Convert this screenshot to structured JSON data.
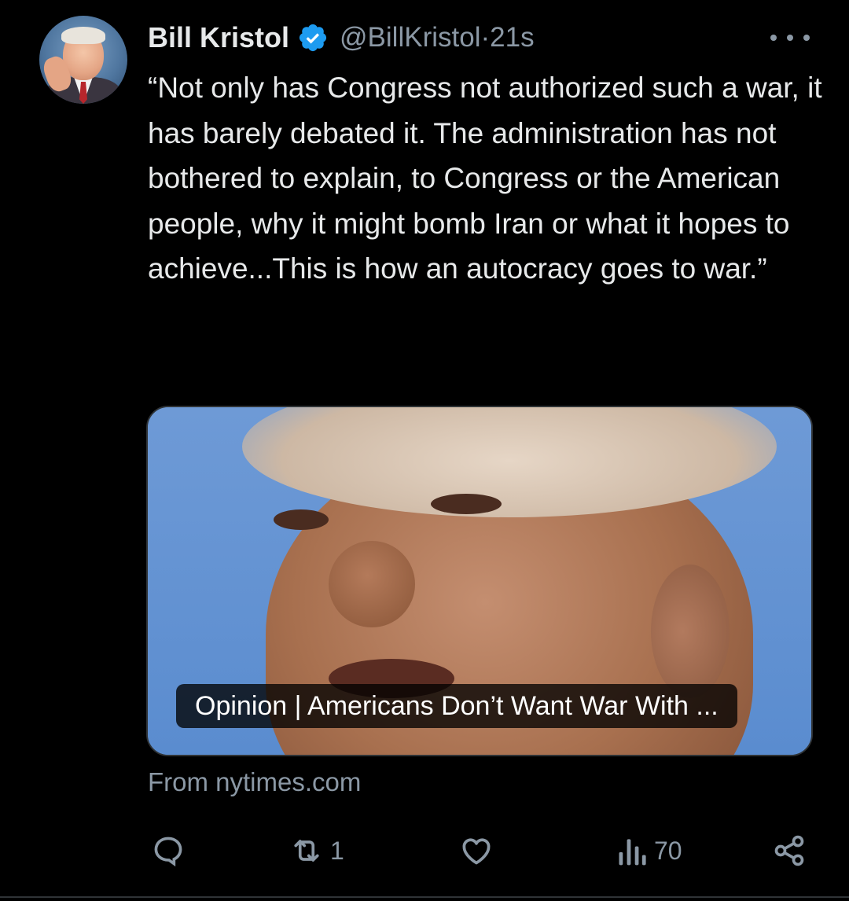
{
  "author": {
    "name": "Bill Kristol",
    "handle": "@BillKristol",
    "time": "21s",
    "verified": true,
    "verified_color": "#1d9bf0"
  },
  "tweet": {
    "text": "“Not only has Congress not authorized such a war, it has barely debated it. The administration has not bothered to explain, to Congress or the American people, why it might bomb Iran or what it hopes to achieve...This is how an autocracy goes to war.”"
  },
  "card": {
    "title": "Opinion | Americans Don’t Want War With ...",
    "source": "From nytimes.com"
  },
  "actions": {
    "reply_icon": "reply-icon",
    "retweet_icon": "retweet-icon",
    "retweet_count": "1",
    "like_icon": "like-icon",
    "views_icon": "views-icon",
    "views_count": "70",
    "share_icon": "share-icon"
  },
  "colors": {
    "background": "#000000",
    "text": "#e7e9ea",
    "muted": "#8b98a5",
    "border": "#2f3336"
  },
  "separator": " · "
}
